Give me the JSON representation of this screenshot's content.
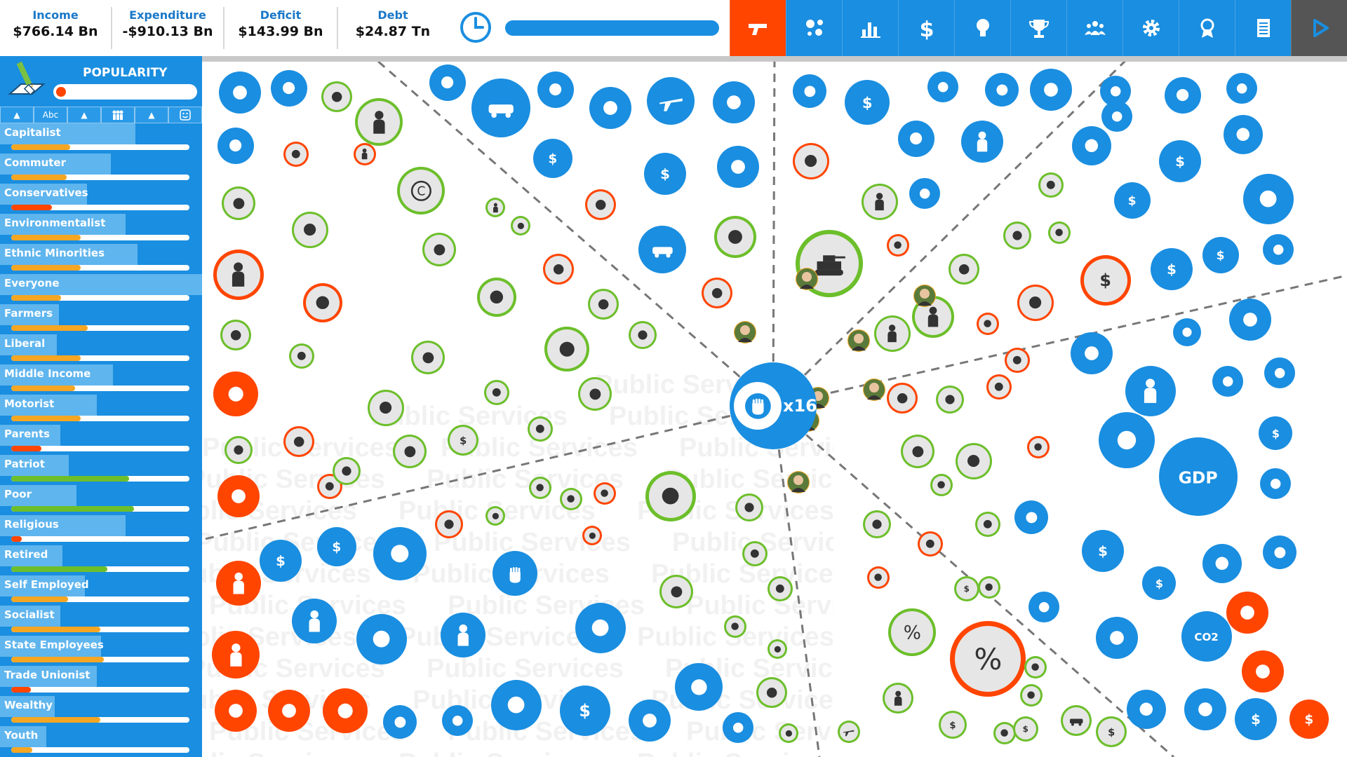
{
  "stats": [
    {
      "label": "Income",
      "value": "$766.14 Bn"
    },
    {
      "label": "Expenditure",
      "value": "-$910.13 Bn"
    },
    {
      "label": "Deficit",
      "value": "$143.99 Bn"
    },
    {
      "label": "Debt",
      "value": "$24.87 Tn"
    }
  ],
  "toolbar": [
    {
      "icon": "gun-icon",
      "active": true
    },
    {
      "icon": "cluster-icon"
    },
    {
      "icon": "bar-chart-icon"
    },
    {
      "icon": "dollar-icon"
    },
    {
      "icon": "lightbulb-icon"
    },
    {
      "icon": "trophy-icon"
    },
    {
      "icon": "group-icon"
    },
    {
      "icon": "gear-icon"
    },
    {
      "icon": "rosette-icon"
    },
    {
      "icon": "document-icon"
    },
    {
      "icon": "play-icon"
    }
  ],
  "popularity": {
    "title": "POPULARITY",
    "sort_buttons": [
      "A",
      "Abc",
      "▲",
      "people",
      "▲",
      "smiley"
    ],
    "groups": [
      {
        "name": "Capitalist",
        "value": 0.33,
        "bg": 0.67,
        "color": "#f5a623"
      },
      {
        "name": "Commuter",
        "value": 0.31,
        "bg": 0.55,
        "color": "#f5a623"
      },
      {
        "name": "Conservatives",
        "value": 0.23,
        "bg": 0.43,
        "color": "#ff4500"
      },
      {
        "name": "Environmentalist",
        "value": 0.39,
        "bg": 0.62,
        "color": "#f5a623"
      },
      {
        "name": "Ethnic Minorities",
        "value": 0.39,
        "bg": 0.68,
        "color": "#f5a623"
      },
      {
        "name": "Everyone",
        "value": 0.28,
        "bg": 1.0,
        "color": "#f5a623"
      },
      {
        "name": "Farmers",
        "value": 0.43,
        "bg": 0.29,
        "color": "#f5a623"
      },
      {
        "name": "Liberal",
        "value": 0.39,
        "bg": 0.28,
        "color": "#f5a623"
      },
      {
        "name": "Middle Income",
        "value": 0.36,
        "bg": 0.56,
        "color": "#f5a623"
      },
      {
        "name": "Motorist",
        "value": 0.39,
        "bg": 0.48,
        "color": "#f5a623"
      },
      {
        "name": "Parents",
        "value": 0.17,
        "bg": 0.3,
        "color": "#ff4500"
      },
      {
        "name": "Patriot",
        "value": 0.66,
        "bg": 0.34,
        "color": "#6cbf2a"
      },
      {
        "name": "Poor",
        "value": 0.69,
        "bg": 0.38,
        "color": "#6cbf2a"
      },
      {
        "name": "Religious",
        "value": 0.06,
        "bg": 0.62,
        "color": "#ff4500"
      },
      {
        "name": "Retired",
        "value": 0.54,
        "bg": 0.31,
        "color": "#6cbf2a"
      },
      {
        "name": "Self Employed",
        "value": 0.32,
        "bg": 0.42,
        "color": "#f5a623"
      },
      {
        "name": "Socialist",
        "value": 0.5,
        "bg": 0.3,
        "color": "#f5a623"
      },
      {
        "name": "State Employees",
        "value": 0.52,
        "bg": 0.5,
        "color": "#f5a623"
      },
      {
        "name": "Trade Unionist",
        "value": 0.11,
        "bg": 0.48,
        "color": "#ff4500"
      },
      {
        "name": "Wealthy",
        "value": 0.5,
        "bg": 0.27,
        "color": "#f5a623"
      },
      {
        "name": "Youth",
        "value": 0.12,
        "bg": 0.23,
        "color": "#f5a623"
      }
    ]
  },
  "center": {
    "label": "x16",
    "icon": "fist-icon"
  },
  "gdp_label": "GDP",
  "co2_label": "CO2",
  "watermark": "Public Services",
  "colors": {
    "blue": "#1a8ee0",
    "red": "#ff4500",
    "gray": "#e6e6e6",
    "green": "#6cbf2a",
    "orange": "#f5a623"
  }
}
